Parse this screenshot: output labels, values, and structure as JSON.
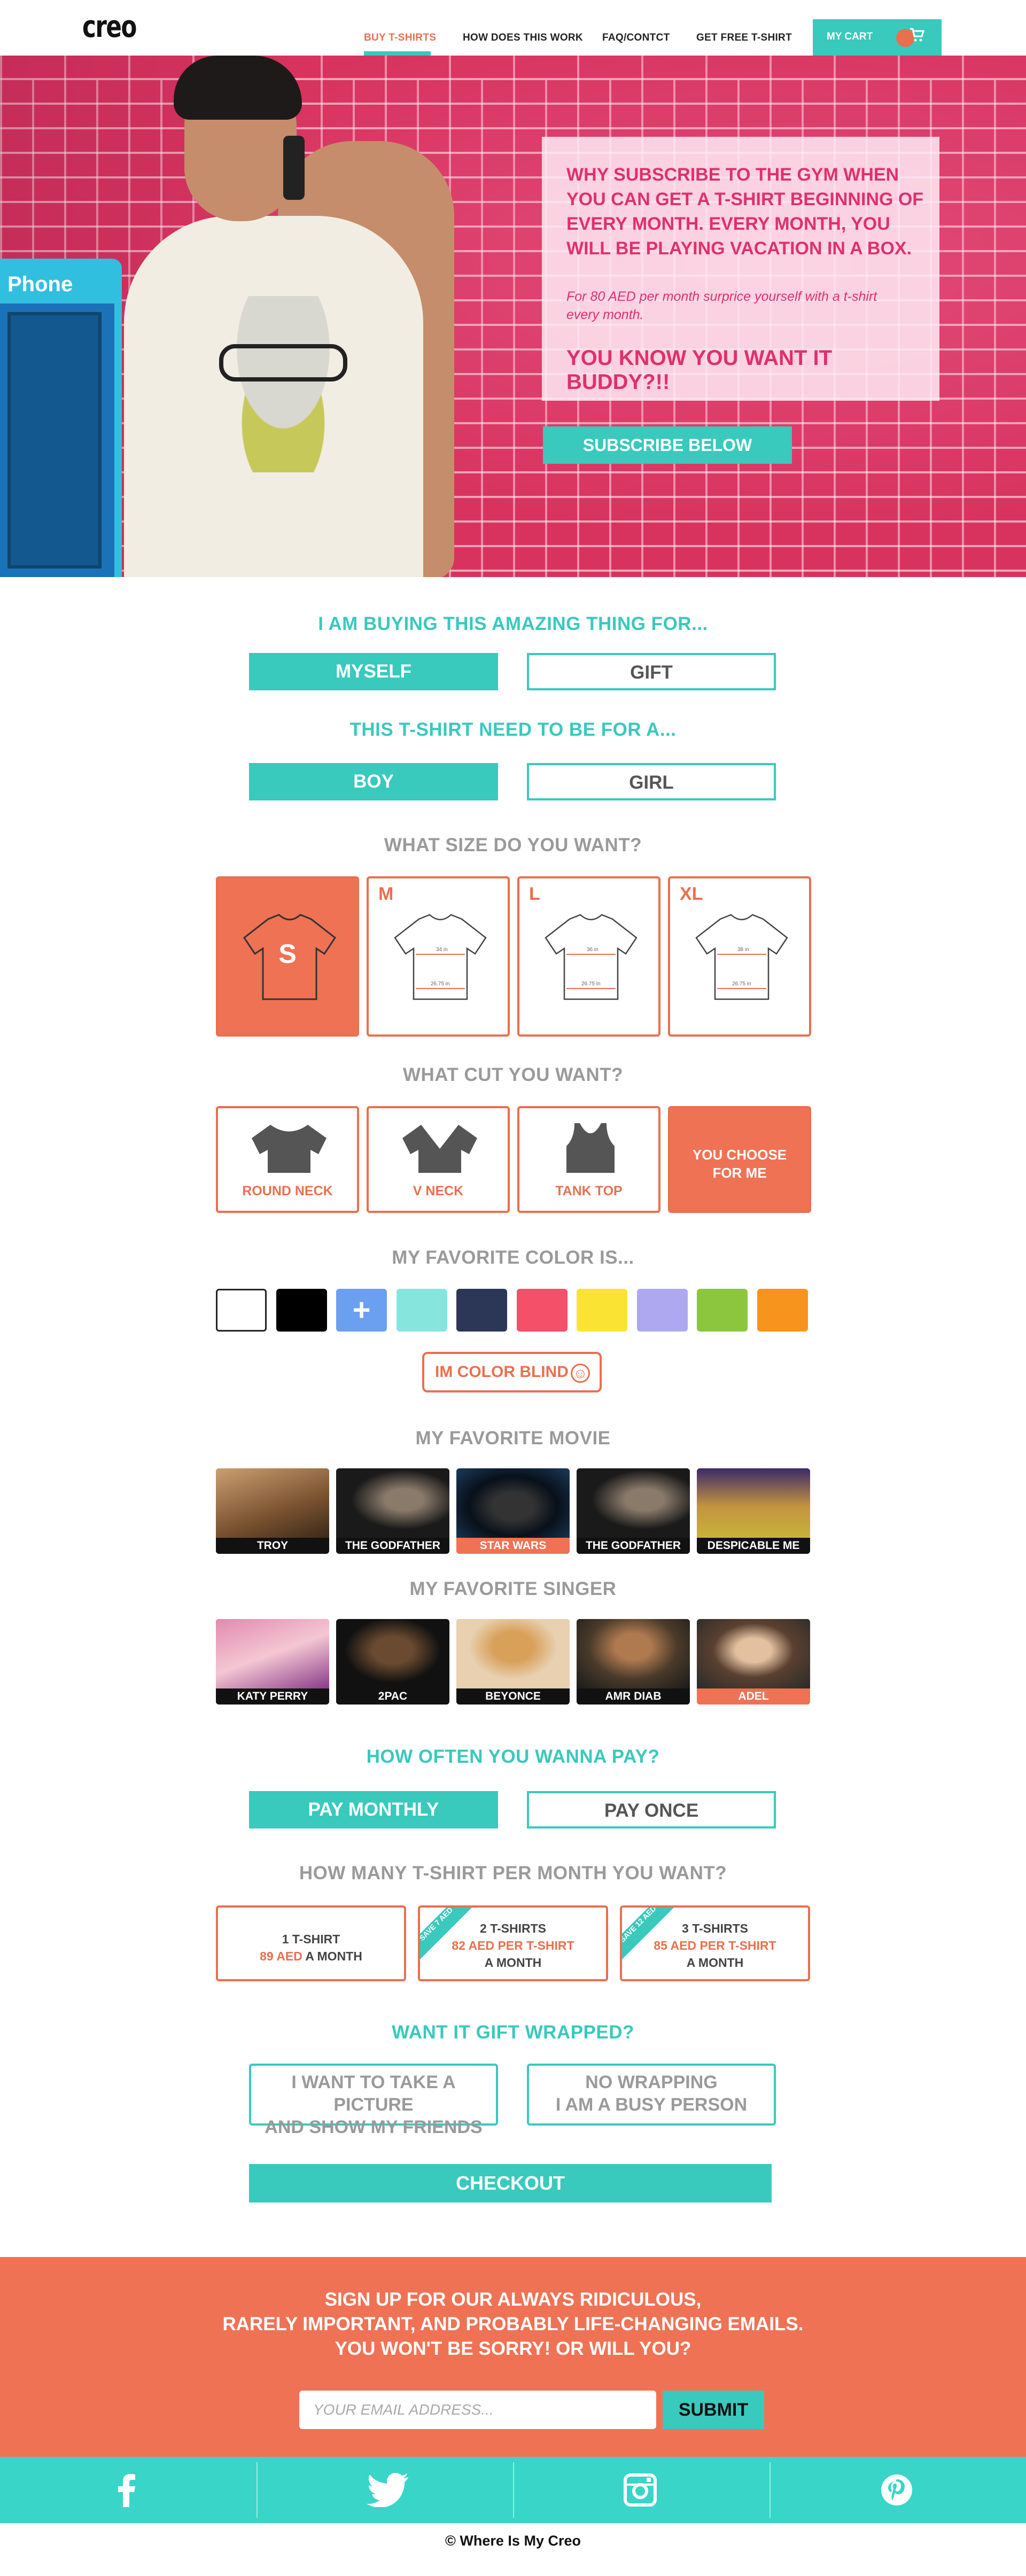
{
  "header": {
    "logo": "creo",
    "nav": [
      {
        "label": "BUY T-SHIRTS",
        "active": true
      },
      {
        "label": "HOW DOES THIS WORK",
        "active": false
      },
      {
        "label": "FAQ/CONTCT",
        "active": false
      },
      {
        "label": "GET FREE T-SHIRT",
        "active": false
      }
    ],
    "cart_label": "MY CART"
  },
  "hero": {
    "booth_sign": "Phone",
    "headline": "WHY SUBSCRIBE TO THE GYM WHEN YOU CAN GET A T-SHIRT BEGINNING OF EVERY MONTH. EVERY MONTH, YOU WILL BE PLAYING VACATION IN A BOX.",
    "subtext": "For 80 AED per month surprice yourself with a t-shirt every month.",
    "tagline": "YOU KNOW YOU WANT IT BUDDY?!!",
    "cta": "SUBSCRIBE BELOW"
  },
  "buying_for": {
    "question": "I AM BUYING THIS AMAZING THING FOR...",
    "options": [
      {
        "label": "MYSELF",
        "selected": true
      },
      {
        "label": "GIFT",
        "selected": false
      }
    ]
  },
  "gender": {
    "question": "THIS T-SHIRT NEED TO BE FOR A...",
    "options": [
      {
        "label": "BOY",
        "selected": true
      },
      {
        "label": "GIRL",
        "selected": false
      }
    ]
  },
  "size": {
    "question": "WHAT SIZE DO YOU WANT?",
    "options": [
      {
        "label": "S",
        "selected": true,
        "chest": "",
        "length": ""
      },
      {
        "label": "M",
        "selected": false,
        "chest": "34 in",
        "length": "26.75 in"
      },
      {
        "label": "L",
        "selected": false,
        "chest": "36 in",
        "length": "26.75 in"
      },
      {
        "label": "XL",
        "selected": false,
        "chest": "38 in",
        "length": "26.75 in"
      }
    ]
  },
  "cut": {
    "question": "WHAT CUT YOU WANT?",
    "options": [
      {
        "label": "ROUND NECK",
        "icon": "round-neck-icon",
        "selected": false
      },
      {
        "label": "V NECK",
        "icon": "v-neck-icon",
        "selected": false
      },
      {
        "label": "TANK TOP",
        "icon": "tank-top-icon",
        "selected": false
      },
      {
        "label": "YOU CHOOSE FOR ME",
        "icon": "",
        "selected": true
      }
    ]
  },
  "color": {
    "question": "MY FAVORITE COLOR IS...",
    "swatches": [
      "#ffffff",
      "#000000",
      "#6b9ff0",
      "#86e6de",
      "#2c3757",
      "#f5506a",
      "#fbe334",
      "#ada8ef",
      "#8cc63f",
      "#f7941d"
    ],
    "plus_symbol": "+",
    "colorblind_label": "IM COLOR BLIND",
    "smiley": "☺"
  },
  "movie": {
    "question": "MY FAVORITE MOVIE",
    "items": [
      {
        "label": "TROY",
        "selected": false
      },
      {
        "label": "THE GODFATHER",
        "selected": false
      },
      {
        "label": "STAR WARS",
        "selected": true
      },
      {
        "label": "THE GODFATHER",
        "selected": false
      },
      {
        "label": "DESPICABLE ME",
        "selected": false
      }
    ]
  },
  "singer": {
    "question": "MY FAVORITE SINGER",
    "items": [
      {
        "label": "KATY PERRY",
        "selected": false
      },
      {
        "label": "2PAC",
        "selected": false
      },
      {
        "label": "BEYONCE",
        "selected": false
      },
      {
        "label": "AMR DIAB",
        "selected": false
      },
      {
        "label": "ADEL",
        "selected": true
      }
    ]
  },
  "payment": {
    "question": "HOW OFTEN YOU WANNA PAY?",
    "options": [
      {
        "label": "PAY MONTHLY",
        "selected": true
      },
      {
        "label": "PAY ONCE",
        "selected": false
      }
    ]
  },
  "quantity": {
    "question": "HOW MANY T-SHIRT PER MONTH YOU WANT?",
    "plans": [
      {
        "count": "1 T-SHIRT",
        "price": "89 AED",
        "price_suffix": "A MONTH",
        "period": "",
        "badge": ""
      },
      {
        "count": "2 T-SHIRTS",
        "price": "82 AED PER T-SHIRT",
        "price_suffix": "",
        "period": "A MONTH",
        "badge": "SAVE 7 AED"
      },
      {
        "count": "3 T-SHIRTS",
        "price": "85 AED PER T-SHIRT",
        "price_suffix": "",
        "period": "A MONTH",
        "badge": "SAVE 12 AED"
      }
    ]
  },
  "gift_wrap": {
    "question": "WANT IT GIFT WRAPPED?",
    "options": [
      {
        "line1": "I WANT TO TAKE A PICTURE",
        "line2": "AND SHOW MY FRIENDS"
      },
      {
        "line1": "NO WRAPPING",
        "line2": "I AM A BUSY PERSON"
      }
    ]
  },
  "checkout_label": "CHECKOUT",
  "newsletter": {
    "line1": "SIGN UP FOR OUR ALWAYS RIDICULOUS,",
    "line2": "RARELY IMPORTANT, AND PROBABLY LIFE-CHANGING EMAILS.",
    "line3": "YOU WON'T BE SORRY! OR WILL YOU?",
    "email_placeholder": "YOUR EMAIL ADDRESS...",
    "submit_label": "SUBMIT"
  },
  "social": [
    "facebook-icon",
    "twitter-icon",
    "instagram-icon",
    "pinterest-icon"
  ],
  "footer": "© Where Is My Creo",
  "colors": {
    "teal": "#39c9bd",
    "coral": "#ef7255",
    "pink": "#e0306b",
    "gray": "#9a9a9a"
  }
}
